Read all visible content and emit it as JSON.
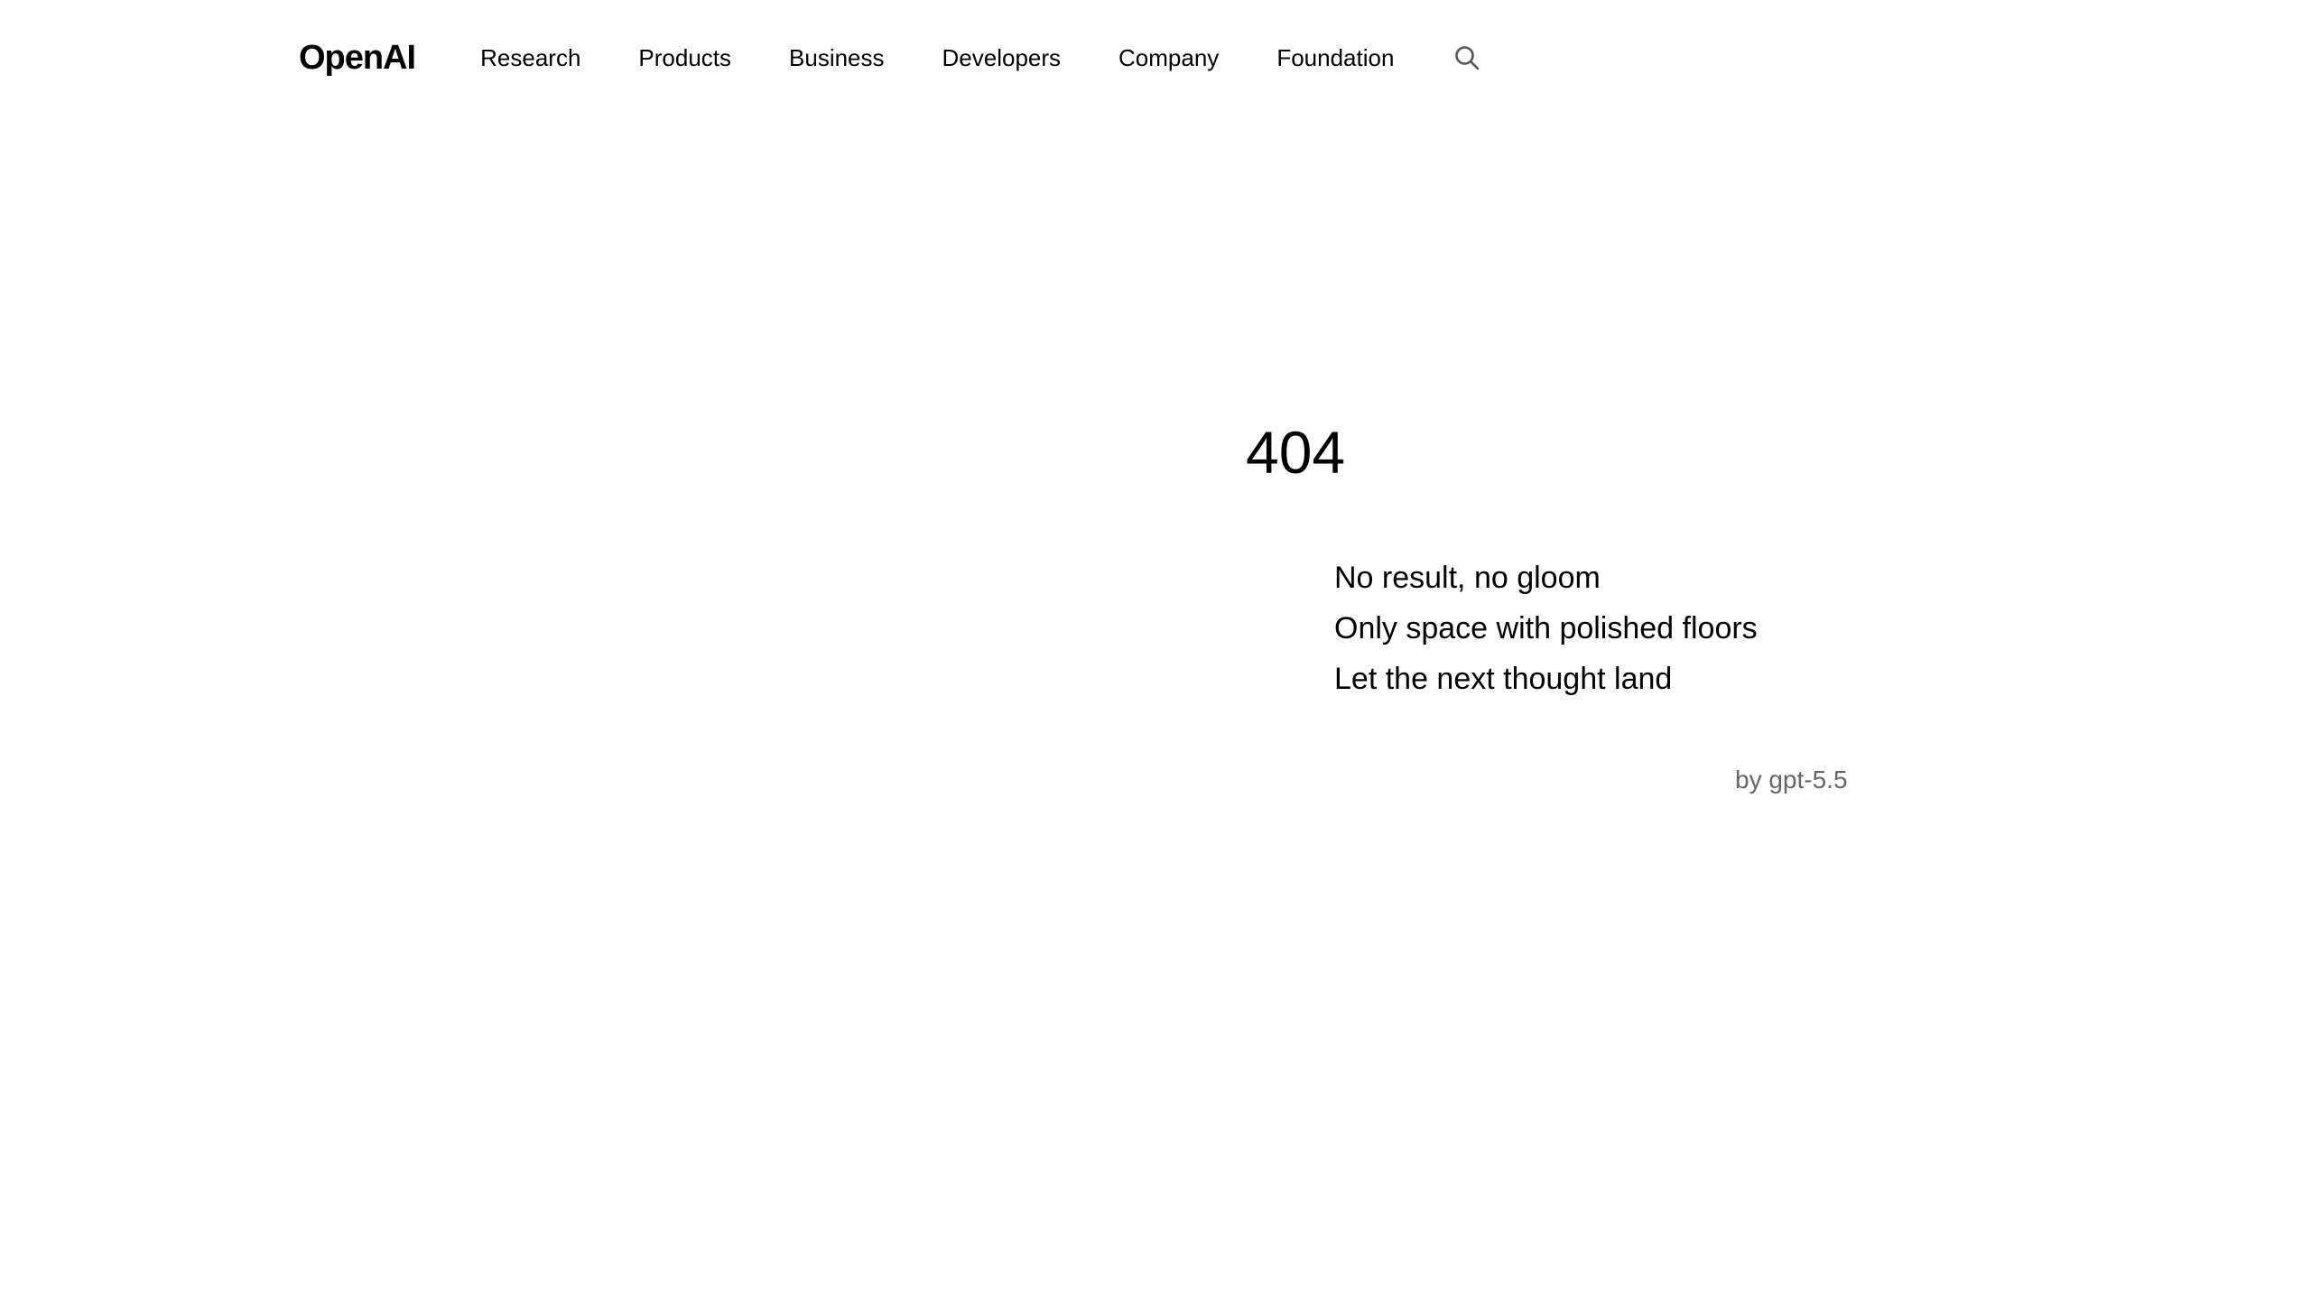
{
  "header": {
    "logo": "OpenAI",
    "nav": [
      {
        "label": "Research"
      },
      {
        "label": "Products"
      },
      {
        "label": "Business"
      },
      {
        "label": "Developers"
      },
      {
        "label": "Company"
      },
      {
        "label": "Foundation"
      }
    ],
    "search_icon": "search-icon"
  },
  "main": {
    "code": "404",
    "poem": [
      "No result, no gloom",
      "Only space with polished floors",
      "Let the next thought land"
    ],
    "attribution": "by gpt-5.5"
  },
  "colors": {
    "background": "#ffffff",
    "text": "#000000",
    "muted": "#666666"
  }
}
